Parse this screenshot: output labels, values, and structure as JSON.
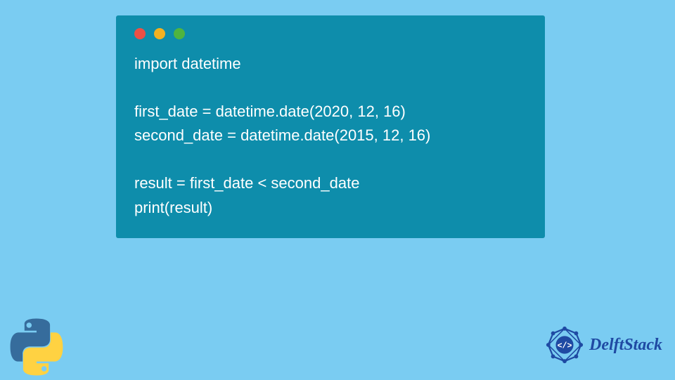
{
  "window": {
    "traffic_lights": [
      "red",
      "yellow",
      "green"
    ]
  },
  "code": {
    "lines": [
      "import datetime",
      "",
      "first_date = datetime.date(2020, 12, 16)",
      "second_date = datetime.date(2015, 12, 16)",
      "",
      "result = first_date < second_date",
      "print(result)"
    ]
  },
  "branding": {
    "delftstack_label": "DelftStack"
  },
  "colors": {
    "page_bg": "#7accf2",
    "window_bg": "#0e8dab",
    "code_text": "#ffffff",
    "brand_text": "#1f4aa3",
    "python_blue": "#366c9c",
    "python_yellow": "#ffd242"
  }
}
